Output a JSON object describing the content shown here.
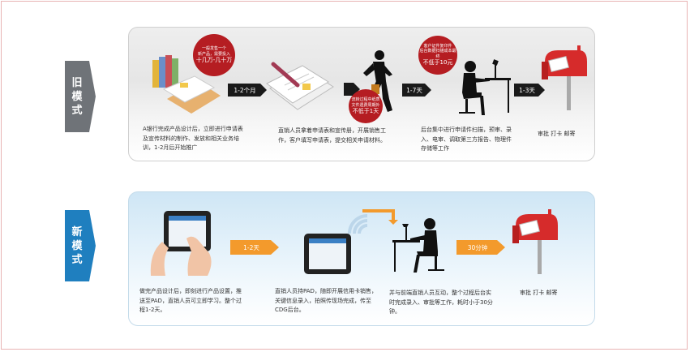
{
  "modes": {
    "old": {
      "label_chars": [
        "旧",
        "模",
        "式"
      ],
      "color": "#6f7378"
    },
    "new": {
      "label_chars": [
        "新",
        "模",
        "式"
      ],
      "color": "#1f7fbf"
    }
  },
  "old_flow": {
    "badges": [
      {
        "small": [
          "一般发售一个",
          "新产品，需要投入"
        ],
        "big": [
          "十几万-几十万"
        ]
      },
      {
        "small": [
          "流转过程中纸质",
          "文件遗费周期外"
        ],
        "big": [
          "不低于1天"
        ]
      },
      {
        "small": [
          "客户证件复印件",
          "后台数据扫描成本最终"
        ],
        "big": [
          "不低于10元"
        ]
      }
    ],
    "arrows": [
      "1-2个月",
      "1-7天",
      "1-3天"
    ],
    "descriptions": [
      "A银行完成产品设计后，立即进行申请表及宣传材料的制作、发放和相关业务培训，1-2月后开始推广",
      "直销人员拿着申请表和宣传册，开展销售工作，客户填写申请表，提交相关申请材料。",
      "后台集中进行申请件扫描，预审、录入、电审、调取第三方报告、物理件存储等工作",
      "审批 打卡 邮寄"
    ]
  },
  "new_flow": {
    "arrows": [
      "1-2天",
      "",
      "30分钟"
    ],
    "descriptions": [
      "做完产品设计后，即刻进行产品设置，推送至PAD，直销人员可立即学习。整个过程1-2天。",
      "直销人员持PAD，随即开展信用卡销售，关键信息录入，拍照传现场完成，传至CDG后台。",
      "并与前端直销人员互动，整个过程后台实时完成录入、审批等工作，耗时小于30分钟。",
      "审批 打卡 邮寄"
    ]
  },
  "colors": {
    "badge": "#b51d22",
    "old_arrow": "#1a1a1a",
    "new_arrow": "#f39a2c",
    "mailbox": "#d62b2b"
  },
  "icons": [
    "document-stack-icon",
    "signing-pen-icon",
    "running-person-icon",
    "office-worker-icon",
    "mailbox-icon",
    "tablet-hands-icon",
    "tablet-icon",
    "wireless-signal-icon",
    "mailbox-icon"
  ]
}
